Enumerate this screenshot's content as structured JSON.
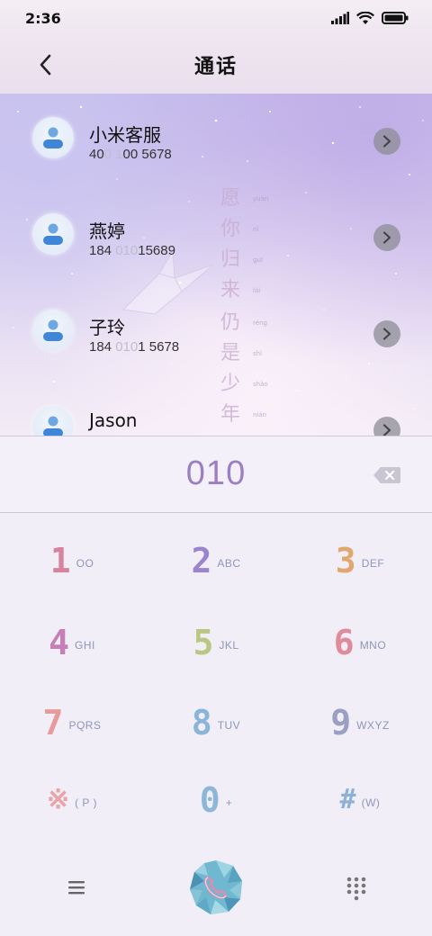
{
  "status_bar": {
    "time": "2:36"
  },
  "header": {
    "title": "通话"
  },
  "wallpaper": {
    "poem_line_1": [
      "愿",
      "你",
      "归",
      "来"
    ],
    "poem_line_2": [
      "仍",
      "是",
      "少",
      "年"
    ],
    "pinyin_line_1": [
      "yuàn",
      "nǐ",
      "guī",
      "lái"
    ],
    "pinyin_line_2": [
      "réng",
      "shì",
      "shào",
      "nián"
    ]
  },
  "contacts": [
    {
      "name": "小米客服",
      "number_parts": [
        "40",
        "0 1",
        "0",
        "0 5678"
      ]
    },
    {
      "name": "燕婷",
      "number_parts": [
        "184 ",
        "010",
        "",
        "15689"
      ]
    },
    {
      "name": "子玲",
      "number_parts": [
        "184 ",
        "010",
        "",
        "1 5678"
      ]
    },
    {
      "name": "Jason",
      "number_parts": [
        "",
        "",
        "",
        ""
      ]
    }
  ],
  "dial_input": {
    "value": "010"
  },
  "keypad": {
    "keys": [
      {
        "digit": "1",
        "letters": "OO",
        "color": "#d9829e"
      },
      {
        "digit": "2",
        "letters": "ABC",
        "color": "#9a84cc"
      },
      {
        "digit": "3",
        "letters": "DEF",
        "color": "#e0a86e"
      },
      {
        "digit": "4",
        "letters": "GHI",
        "color": "#c77fb8"
      },
      {
        "digit": "5",
        "letters": "JKL",
        "color": "#b8c882"
      },
      {
        "digit": "6",
        "letters": "MNO",
        "color": "#e08a9a"
      },
      {
        "digit": "7",
        "letters": "PQRS",
        "color": "#e79a9a"
      },
      {
        "digit": "8",
        "letters": "TUV",
        "color": "#8ab4d8"
      },
      {
        "digit": "9",
        "letters": "WXYZ",
        "color": "#9aa0c4"
      },
      {
        "digit": "※",
        "letters": "( P )",
        "color": "#e8a4a8"
      },
      {
        "digit": "0",
        "letters": "+",
        "color": "#8cb8d8"
      },
      {
        "digit": "#",
        "letters": "(W)",
        "color": "#8cb0d8"
      }
    ]
  },
  "colors": {
    "accent": "#9a80c2",
    "chevron_bg": "#8c8c96",
    "call_button": "#5fb0c8"
  }
}
